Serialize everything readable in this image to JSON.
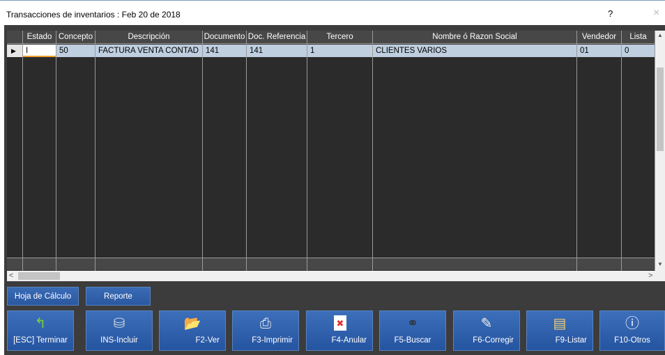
{
  "window": {
    "title": "Transacciones de inventarios : Feb 20 de 2018",
    "help_label": "?",
    "close_label": "×"
  },
  "grid": {
    "columns": [
      "Estado",
      "Concepto",
      "Descripción",
      "Documento",
      "Doc. Referencia",
      "Tercero",
      "Nombre ó Razon Social",
      "Vendedor",
      "Lista"
    ],
    "rows": [
      [
        "I",
        "50",
        "FACTURA VENTA CONTAD",
        "141",
        "141",
        "1",
        "CLIENTES VARIOS",
        "01",
        "0"
      ]
    ],
    "row_indicator": "▶"
  },
  "scroll": {
    "up": "▲",
    "down": "▼",
    "left": "<",
    "right": ">"
  },
  "secondary_buttons": [
    {
      "label": "Hoja de Cálculo"
    },
    {
      "label": "Reporte"
    }
  ],
  "toolbar": [
    {
      "label": "[ESC] Terminar",
      "icon": "exit-arrow-icon",
      "glyph": "↰",
      "color": "#7ccf3a"
    },
    {
      "label": "INS-Incluir",
      "icon": "add-database-icon",
      "glyph": "⛁",
      "color": "#cfd6dd"
    },
    {
      "label": "F2-Ver",
      "icon": "folder-icon",
      "glyph": "📂",
      "color": "#f4c542"
    },
    {
      "label": "F3-Imprimir",
      "icon": "printer-icon",
      "glyph": "⎙",
      "color": "#e8e8e8"
    },
    {
      "label": "F4-Anular",
      "icon": "cancel-document-icon",
      "glyph": "✖",
      "color": "#e0332d"
    },
    {
      "label": "F5-Buscar",
      "icon": "binoculars-icon",
      "glyph": "⚭",
      "color": "#333333"
    },
    {
      "label": "F6-Corregir",
      "icon": "edit-document-icon",
      "glyph": "✎",
      "color": "#f0f0f0"
    },
    {
      "label": "F9-Listar",
      "icon": "list-documents-icon",
      "glyph": "▤",
      "color": "#f0d070"
    },
    {
      "label": "F10-Otros",
      "icon": "info-icon",
      "glyph": "ⓘ",
      "color": "#ffffff"
    }
  ]
}
